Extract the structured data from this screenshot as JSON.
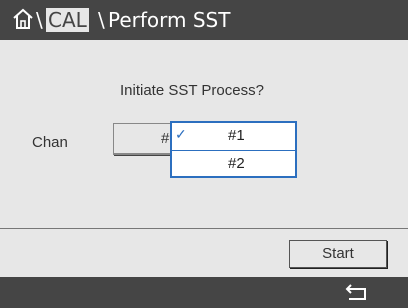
{
  "header": {
    "home_icon": "home-icon",
    "sep1": "\\",
    "crumb1": "CAL",
    "sep2": "\\",
    "crumb2": "Perform SST"
  },
  "main": {
    "prompt": "Initiate SST Process?",
    "chan_label": "Chan",
    "chan_selected": "#",
    "dropdown": {
      "options": [
        {
          "label": "#1",
          "checked": true
        },
        {
          "label": "#2",
          "checked": false
        }
      ]
    },
    "start_label": "Start"
  },
  "footer": {
    "back_icon": "back-arrow-icon"
  },
  "colors": {
    "titlebar": "#454545",
    "background": "#e7e7e7",
    "accent": "#2c6fbf"
  }
}
